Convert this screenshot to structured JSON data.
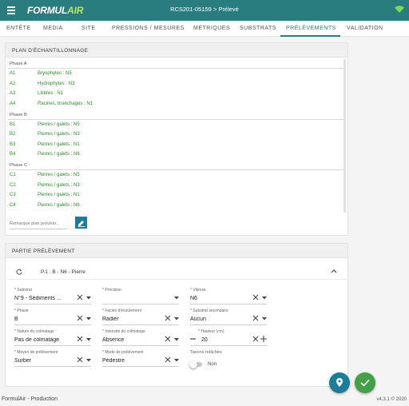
{
  "app": {
    "logo_part1": "FORMUL",
    "logo_part2": "AIR",
    "title": "RCS201-05159 > Prélevé"
  },
  "tabs": [
    {
      "label": "ENTÊTE"
    },
    {
      "label": "MEDIA"
    },
    {
      "label": "SITE"
    },
    {
      "label": "PRESSIONS / MESURES"
    },
    {
      "label": "MÉTRIQUES"
    },
    {
      "label": "SUBSTRATS"
    },
    {
      "label": "PRÉLÈVEMENTS",
      "active": true
    },
    {
      "label": "VALIDATION"
    }
  ],
  "plan": {
    "header": "PLAN D'ÉCHANTILLONNAGE",
    "phases": [
      {
        "label": "Phase A",
        "rows": [
          {
            "code": "A1",
            "value": "Bryophytes : N5"
          },
          {
            "code": "A2",
            "value": "Hydrophytes : N3"
          },
          {
            "code": "A3",
            "value": "Litières : N1"
          },
          {
            "code": "A4",
            "value": "Racines, branchages : N1"
          }
        ]
      },
      {
        "label": "Phase B",
        "rows": [
          {
            "code": "B1",
            "value": "Pierres / galets : N5"
          },
          {
            "code": "B2",
            "value": "Pierres / galets : N3"
          },
          {
            "code": "B3",
            "value": "Pierres / galets : N1"
          },
          {
            "code": "B4",
            "value": "Pierres / galets : N6"
          }
        ]
      },
      {
        "label": "Phase C",
        "rows": [
          {
            "code": "C1",
            "value": "Pierres / galets : N5"
          },
          {
            "code": "C2",
            "value": "Pierres / galets : N3"
          },
          {
            "code": "C3",
            "value": "Pierres / galets : N1"
          },
          {
            "code": "C4",
            "value": "Pierres / galets : N6"
          }
        ]
      }
    ],
    "remark_placeholder": "Remarque plan prévisio..."
  },
  "partie": {
    "header": "PARTIE PRÉLÈVEMENT",
    "sub_title": "P.1 : B - N6 - Pierre",
    "fields": {
      "substrat": {
        "label": "* Substrat",
        "value": "N°9 - Sédiments ..."
      },
      "precision": {
        "label": "* Précision",
        "value": ""
      },
      "vitesse": {
        "label": "* Vitesse",
        "value": "N6"
      },
      "phase": {
        "label": "* Phase",
        "value": "B"
      },
      "facies": {
        "label": "* Faciès d'écoulement",
        "value": "Radier"
      },
      "substrat_sec": {
        "label": "* Substrat secondaire",
        "value": "Aucun"
      },
      "nature": {
        "label": "* Nature du colmatage",
        "value": "Pas de colmatage"
      },
      "intensite": {
        "label": "* Intensité du colmatage",
        "value": "Absence"
      },
      "hauteur": {
        "label": "* Hauteur (cm)",
        "value": "20"
      },
      "moyen": {
        "label": "* Moyen de prélèvement",
        "value": "Surber"
      },
      "mode": {
        "label": "* Mode de prélèvement",
        "value": "Pédestre"
      },
      "taxons": {
        "label": "Taxons relâchés",
        "value": "Non"
      }
    }
  },
  "footer": {
    "left": "FormulAir - Production",
    "right": "v4.3.1 © 2020"
  },
  "colors": {
    "primary": "#2a7d7e",
    "green_text": "#2e8b2e",
    "fab_blue": "#1b7d99",
    "fab_green": "#43a047",
    "logo_accent": "#b9e36b"
  },
  "icons": [
    "menu-icon",
    "wifi-icon",
    "edit-icon",
    "refresh-icon",
    "chevron-up-icon",
    "close-icon",
    "caret-down-icon",
    "minus-icon",
    "plus-icon",
    "location-icon",
    "check-icon"
  ]
}
